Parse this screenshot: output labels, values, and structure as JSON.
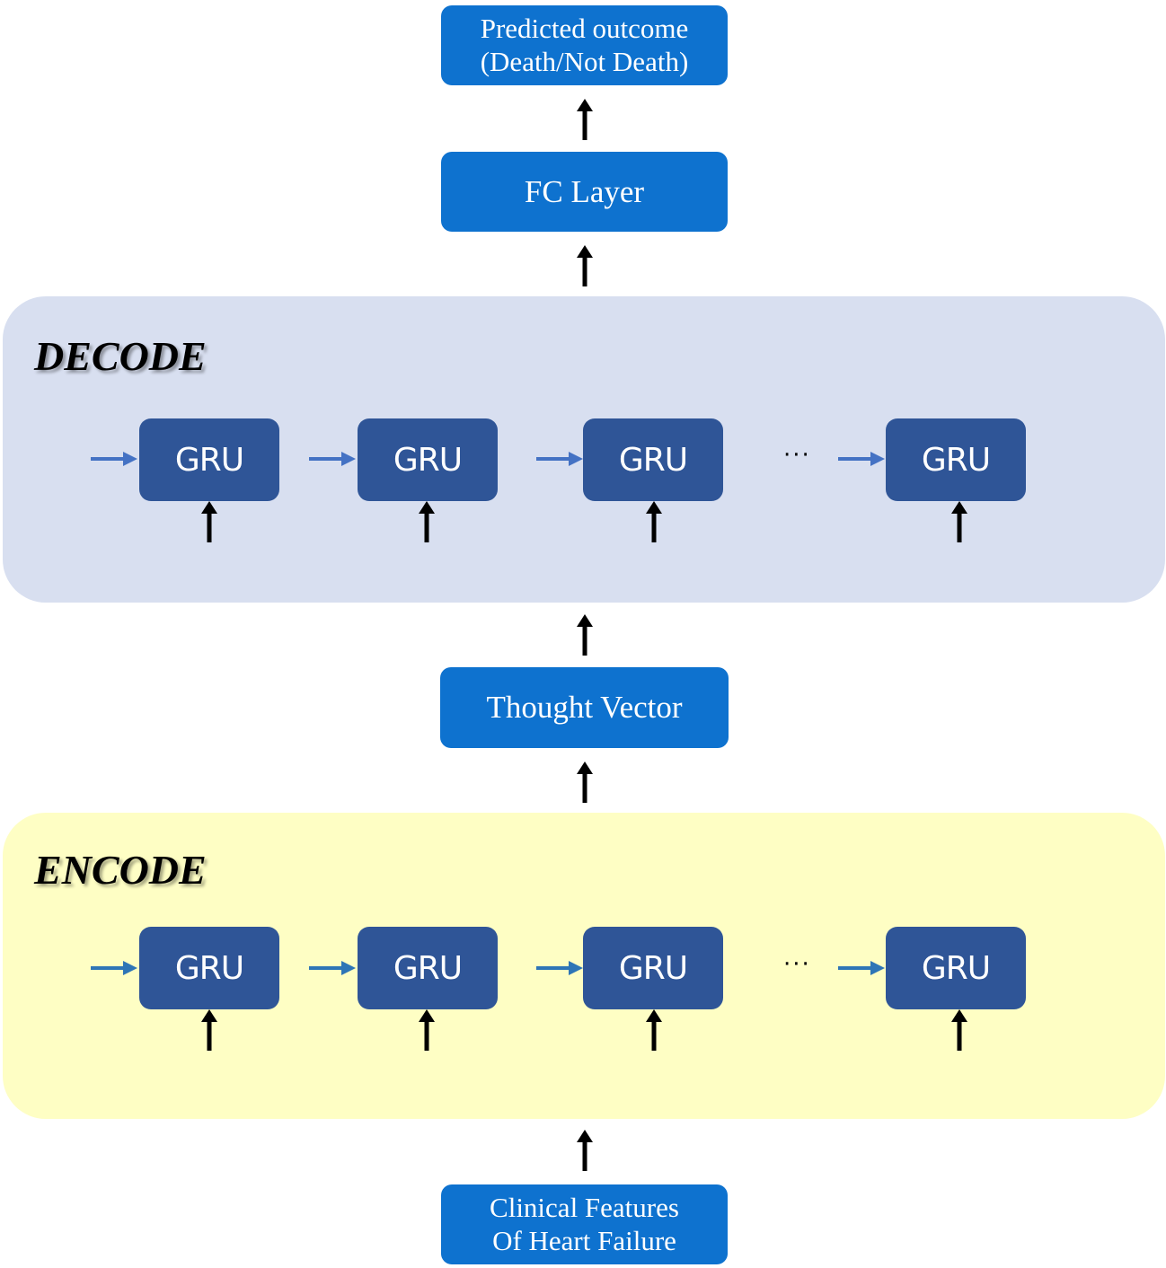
{
  "nodes": {
    "predicted_outcome": {
      "line1": "Predicted outcome",
      "line2": "(Death/Not Death)"
    },
    "fc_layer": {
      "label": "FC Layer"
    },
    "thought_vector": {
      "label": "Thought Vector"
    },
    "clinical_features": {
      "line1": "Clinical Features",
      "line2": "Of Heart Failure"
    }
  },
  "decode": {
    "title": "DECODE",
    "cells": [
      "GRU",
      "GRU",
      "GRU",
      "GRU"
    ],
    "ellipsis": "···"
  },
  "encode": {
    "title": "ENCODE",
    "cells": [
      "GRU",
      "GRU",
      "GRU",
      "GRU"
    ],
    "ellipsis": "···"
  },
  "colors": {
    "node_blue": "#0e72cf",
    "gru_blue": "#2f5597",
    "decode_bg": "#d8dff0",
    "encode_bg": "#fefec4",
    "decode_arrow": "#4472c4",
    "encode_arrow": "#2e75b6",
    "flow_arrow": "#000000"
  }
}
